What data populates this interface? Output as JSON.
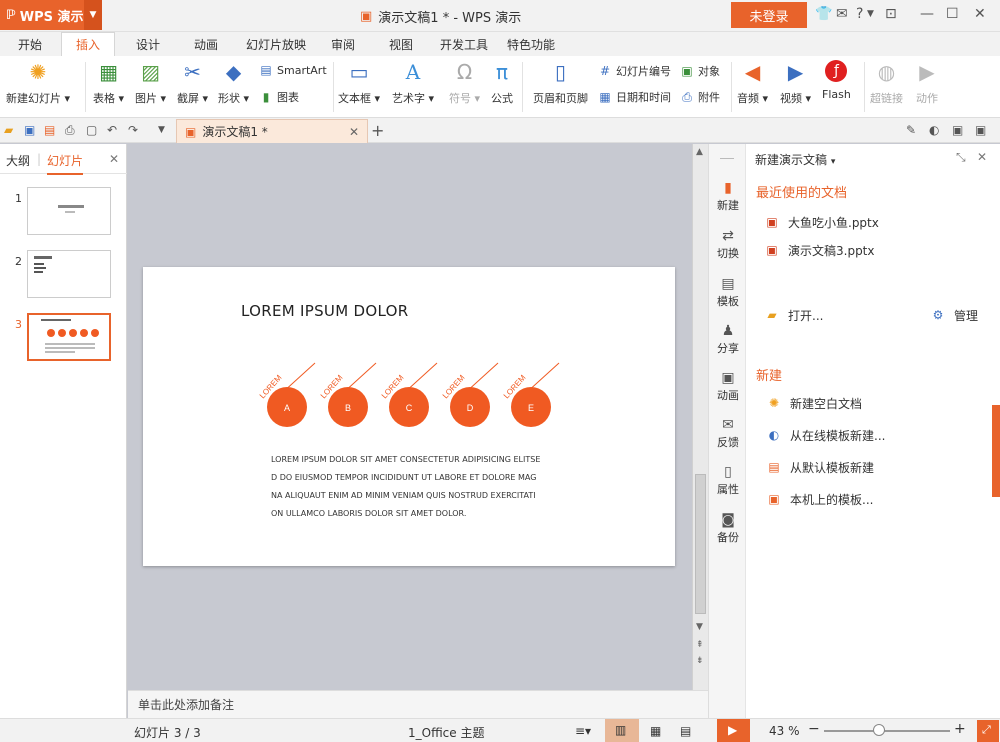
{
  "app": {
    "logo": "WPS 演示",
    "doc_title": "演示文稿1 * - WPS 演示",
    "login": "未登录",
    "help": "?"
  },
  "tabs": [
    "开始",
    "插入",
    "设计",
    "动画",
    "幻灯片放映",
    "审阅",
    "视图",
    "开发工具",
    "特色功能"
  ],
  "ribbon": {
    "new_slide": "新建幻灯片",
    "table": "表格",
    "picture": "图片",
    "screenshot": "截屏",
    "shapes": "形状",
    "smartart": "SmartArt",
    "chart": "图表",
    "textbox": "文本框",
    "wordart": "艺术字",
    "symbol": "符号",
    "formula": "公式",
    "header_footer": "页眉和页脚",
    "slide_number": "幻灯片编号",
    "object": "对象",
    "date_time": "日期和时间",
    "attachment": "附件",
    "audio": "音频",
    "video": "视频",
    "flash": "Flash",
    "hyperlink": "超链接",
    "action": "动作"
  },
  "doctab": {
    "label": "演示文稿1 *"
  },
  "left_panel": {
    "outline": "大纲",
    "slides": "幻灯片",
    "nums": [
      "1",
      "2",
      "3"
    ]
  },
  "slide": {
    "title": "LOREM IPSUM DOLOR",
    "circles": [
      {
        "letter": "A",
        "tag": "LOREM"
      },
      {
        "letter": "B",
        "tag": "LOREM"
      },
      {
        "letter": "C",
        "tag": "LOREM"
      },
      {
        "letter": "D",
        "tag": "LOREM"
      },
      {
        "letter": "E",
        "tag": "LOREM"
      }
    ],
    "body": [
      "LOREM IPSUM DOLOR SIT AMET CONSECTETUR ADIPISICING ELITSE",
      "D DO EIUSMOD TEMPOR INCIDIDUNT UT LABORE ET DOLORE MAG",
      "NA ALIQUAUT ENIM AD MINIM VENIAM QUIS NOSTRUD EXERCITATI",
      "ON ULLAMCO LABORIS  DOLOR SIT AMET DOLOR."
    ]
  },
  "notes": "单击此处添加备注",
  "side_nav": [
    "新建",
    "切换",
    "模板",
    "分享",
    "动画",
    "反馈",
    "属性",
    "备份"
  ],
  "taskpane": {
    "header": "新建演示文稿",
    "recent_title": "最近使用的文档",
    "recent": [
      "大鱼吃小鱼.pptx",
      "演示文稿3.pptx"
    ],
    "open": "打开...",
    "manage": "管理",
    "new_title": "新建",
    "new_items": [
      "新建空白文档",
      "从在线模板新建...",
      "从默认模板新建",
      "本机上的模板..."
    ]
  },
  "status": {
    "slide_count": "幻灯片 3 / 3",
    "theme": "1_Office 主题",
    "zoom": "43 %",
    "zoom_fraction": 0.43
  },
  "colors": {
    "accent": "#e8632b",
    "circle": "#f05a22"
  }
}
